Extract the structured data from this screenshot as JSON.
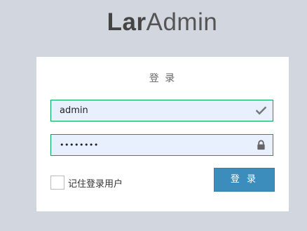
{
  "logo": {
    "bold": "Lar",
    "light": "Admin"
  },
  "login": {
    "title": "登 录",
    "username_value": "admin",
    "password_value": "••••••••",
    "remember_label": "记住登录用户",
    "submit_label": "登 录"
  },
  "icons": {
    "username": "check-icon",
    "password": "lock-icon"
  },
  "colors": {
    "page_background": "#d2d6de",
    "card_background": "#ffffff",
    "input_border": "#00a65a",
    "input_background": "#e8f0fe",
    "button": "#3c8dbc"
  }
}
